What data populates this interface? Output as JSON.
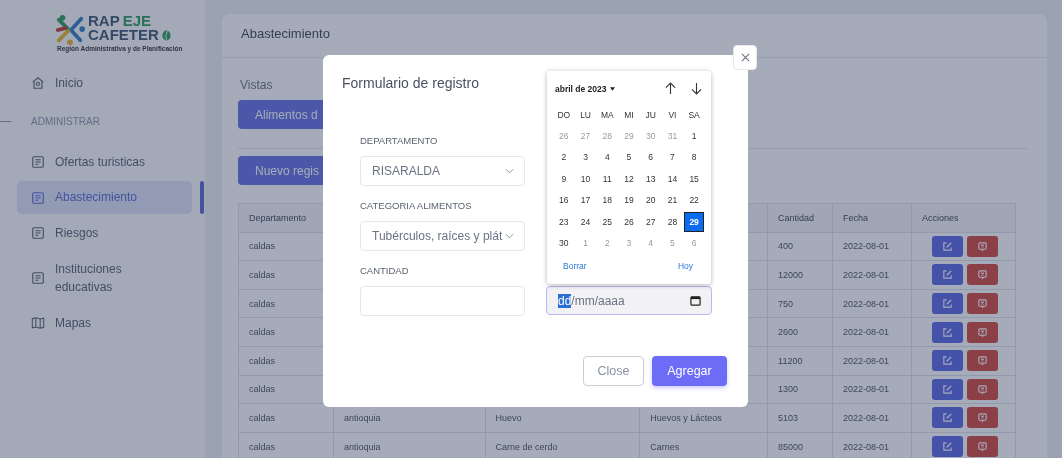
{
  "sidebar": {
    "logo": {
      "word_1": "RAP",
      "word_2": "EJE",
      "word_3": "CAFETER",
      "subtitle": "Región Administrativa y de Planificación"
    },
    "home": {
      "label": "Inicio",
      "selected": false
    },
    "section": "ADMINISTRAR",
    "items": [
      {
        "label": "Ofertas turisticas",
        "selected": false
      },
      {
        "label": "Abastecimiento",
        "selected": true
      },
      {
        "label": "Riesgos",
        "selected": false
      },
      {
        "label": "Instituciones educativas",
        "selected": false
      },
      {
        "label": "Mapas",
        "selected": false
      }
    ]
  },
  "page": {
    "title": "Abastecimiento",
    "views_label": "Vistas",
    "view_button": "Alimentos d",
    "new_button": "Nuevo regis",
    "table": {
      "columns": [
        "Departamento",
        null,
        null,
        null,
        "Cantidad",
        "Fecha",
        "Acciones"
      ],
      "rows": [
        [
          "caldas",
          null,
          null,
          null,
          "400",
          "2022-08-01"
        ],
        [
          "caldas",
          null,
          null,
          null,
          "12000",
          "2022-08-01"
        ],
        [
          "caldas",
          null,
          null,
          null,
          "750",
          "2022-08-01"
        ],
        [
          "caldas",
          null,
          null,
          null,
          "2600",
          "2022-08-01"
        ],
        [
          "caldas",
          null,
          null,
          null,
          "11200",
          "2022-08-01"
        ],
        [
          "caldas",
          null,
          null,
          null,
          "1300",
          "2022-08-01"
        ],
        [
          "caldas",
          "antioquia",
          "Huevo",
          "Huevos y Lácteos",
          "5103",
          "2022-08-01"
        ],
        [
          "caldas",
          "antioquia",
          "Carne de cerdo",
          "Carnes",
          "85000",
          "2022-08-01"
        ]
      ]
    }
  },
  "modal": {
    "title": "Formulario de registro",
    "fields": [
      {
        "label": "DEPARTAMENTO",
        "kind": "select",
        "value": "RISARALDA"
      },
      {
        "label": "CATEGORIA ALIMENTOS",
        "kind": "select",
        "value": "Tubérculos, raíces y plát"
      },
      {
        "label": "CANTIDAD",
        "kind": "input"
      }
    ],
    "date_field": {
      "parts": [
        {
          "text": "dd",
          "selected": true
        },
        {
          "text": "/mm/aaaa",
          "selected": false
        }
      ]
    },
    "calendar": {
      "month": "abril de 2023",
      "weekdays": [
        "DO",
        "LU",
        "MA",
        "MI",
        "JU",
        "VI",
        "SA"
      ],
      "weeks": [
        [
          {
            "day": "26",
            "muted": true,
            "selected": false
          },
          {
            "day": "27",
            "muted": true,
            "selected": false
          },
          {
            "day": "28",
            "muted": true,
            "selected": false
          },
          {
            "day": "29",
            "muted": true,
            "selected": false
          },
          {
            "day": "30",
            "muted": true,
            "selected": false
          },
          {
            "day": "31",
            "muted": true,
            "selected": false
          },
          {
            "day": "1",
            "muted": false,
            "selected": false
          }
        ],
        [
          {
            "day": "2",
            "muted": false,
            "selected": false
          },
          {
            "day": "3",
            "muted": false,
            "selected": false
          },
          {
            "day": "4",
            "muted": false,
            "selected": false
          },
          {
            "day": "5",
            "muted": false,
            "selected": false
          },
          {
            "day": "6",
            "muted": false,
            "selected": false
          },
          {
            "day": "7",
            "muted": false,
            "selected": false
          },
          {
            "day": "8",
            "muted": false,
            "selected": false
          }
        ],
        [
          {
            "day": "9",
            "muted": false,
            "selected": false
          },
          {
            "day": "10",
            "muted": false,
            "selected": false
          },
          {
            "day": "11",
            "muted": false,
            "selected": false
          },
          {
            "day": "12",
            "muted": false,
            "selected": false
          },
          {
            "day": "13",
            "muted": false,
            "selected": false
          },
          {
            "day": "14",
            "muted": false,
            "selected": false
          },
          {
            "day": "15",
            "muted": false,
            "selected": false
          }
        ],
        [
          {
            "day": "16",
            "muted": false,
            "selected": false
          },
          {
            "day": "17",
            "muted": false,
            "selected": false
          },
          {
            "day": "18",
            "muted": false,
            "selected": false
          },
          {
            "day": "19",
            "muted": false,
            "selected": false
          },
          {
            "day": "20",
            "muted": false,
            "selected": false
          },
          {
            "day": "21",
            "muted": false,
            "selected": false
          },
          {
            "day": "22",
            "muted": false,
            "selected": false
          }
        ],
        [
          {
            "day": "23",
            "muted": false,
            "selected": false
          },
          {
            "day": "24",
            "muted": false,
            "selected": false
          },
          {
            "day": "25",
            "muted": false,
            "selected": false
          },
          {
            "day": "26",
            "muted": false,
            "selected": false
          },
          {
            "day": "27",
            "muted": false,
            "selected": false
          },
          {
            "day": "28",
            "muted": false,
            "selected": false
          },
          {
            "day": "29",
            "muted": false,
            "selected": true
          }
        ],
        [
          {
            "day": "30",
            "muted": false,
            "selected": false
          },
          {
            "day": "1",
            "muted": true,
            "selected": false
          },
          {
            "day": "2",
            "muted": true,
            "selected": false
          },
          {
            "day": "3",
            "muted": true,
            "selected": false
          },
          {
            "day": "4",
            "muted": true,
            "selected": false
          },
          {
            "day": "5",
            "muted": true,
            "selected": false
          },
          {
            "day": "6",
            "muted": true,
            "selected": false
          }
        ]
      ],
      "clear": "Borrar",
      "today": "Hoy"
    },
    "buttons": [
      {
        "label": "Close",
        "kind": "secondary"
      },
      {
        "label": "Agregar",
        "kind": "primary"
      }
    ]
  }
}
